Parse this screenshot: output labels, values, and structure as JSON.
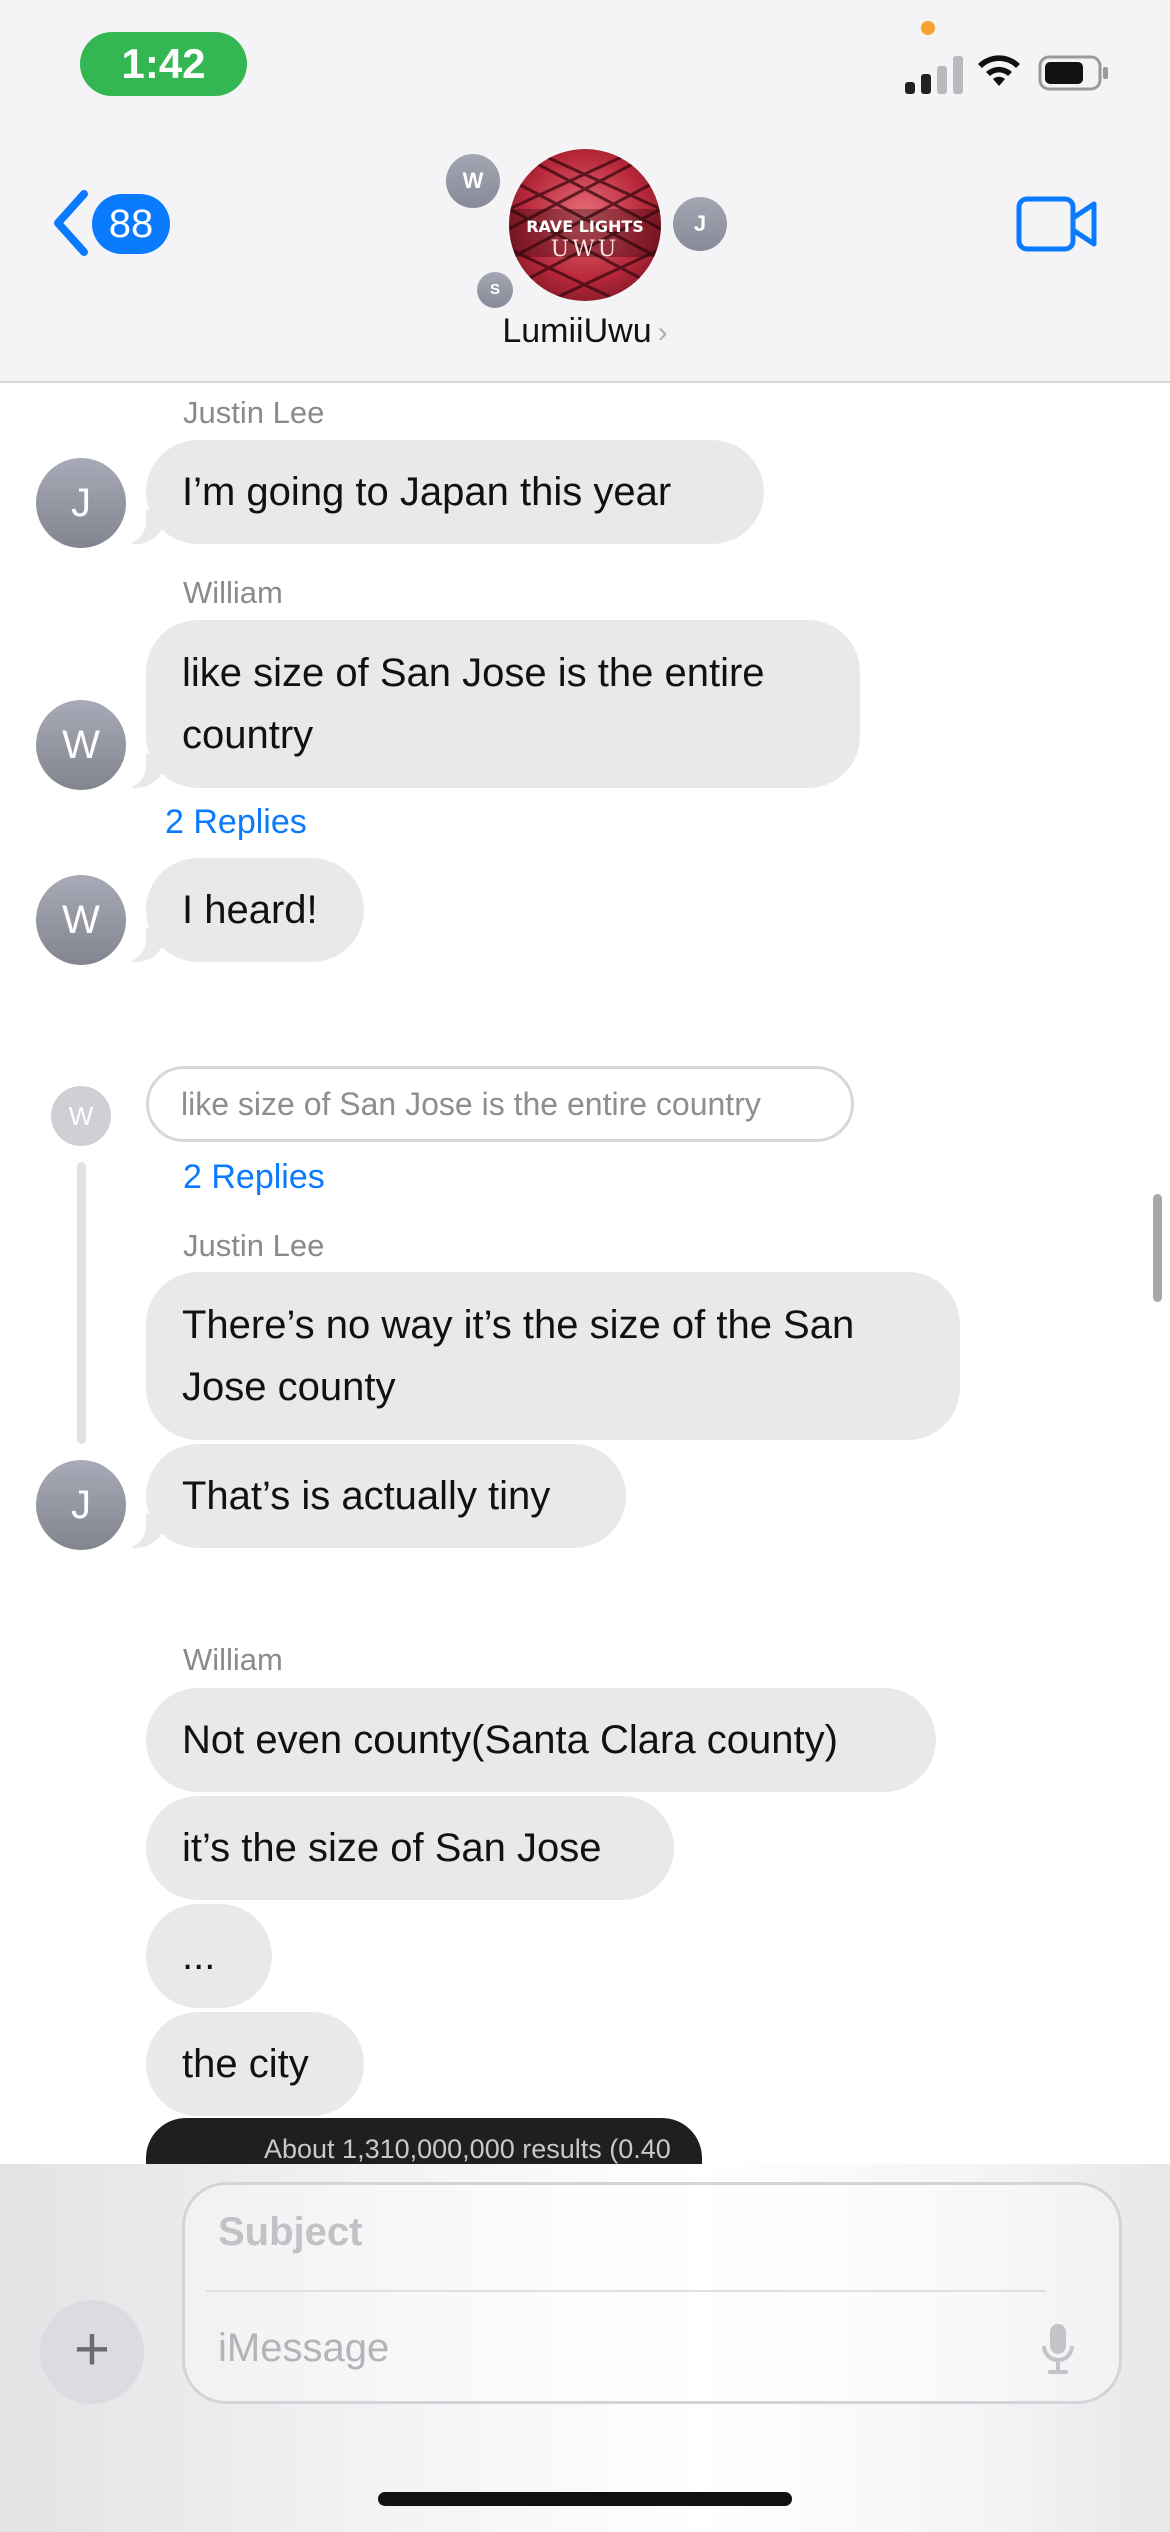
{
  "status_bar": {
    "time": "1:42"
  },
  "header": {
    "back_count": "88",
    "group_name": "LumiiUwu",
    "member_initials": [
      "W",
      "J",
      "S"
    ],
    "group_photo_text_top": "RAVE LIGHTS",
    "group_photo_text_bottom": "UWU"
  },
  "messages": {
    "m1_sender": "Justin Lee",
    "m1_text": "I’m going to Japan this year",
    "m1_avatar": "J",
    "m2_sender": "William",
    "m2_text": "like size of San Jose is the entire country",
    "m2_avatar": "W",
    "m2_replies": "2 Replies",
    "m3_text": "I heard!",
    "m3_avatar": "W",
    "thread_quote": "like size of San Jose is the entire country",
    "thread_avatar": "W",
    "thread_replies": "2 Replies",
    "m4_sender": "Justin Lee",
    "m4_text": "There’s no way it’s the size of the San Jose county",
    "m5_text": "That’s is actually tiny",
    "m5_avatar": "J",
    "m6_sender": "William",
    "m6_text": "Not even county(Santa Clara county)",
    "m7_text": "it’s the size of San Jose",
    "m8_text": "...",
    "m9_text": "the city",
    "link_preview_text": "About 1,310,000,000 results (0.40"
  },
  "composer": {
    "subject_placeholder": "Subject",
    "message_placeholder": "iMessage"
  },
  "colors": {
    "accent": "#0a7aff",
    "bubble": "#e9e9eb",
    "time_pill": "#34b653"
  }
}
